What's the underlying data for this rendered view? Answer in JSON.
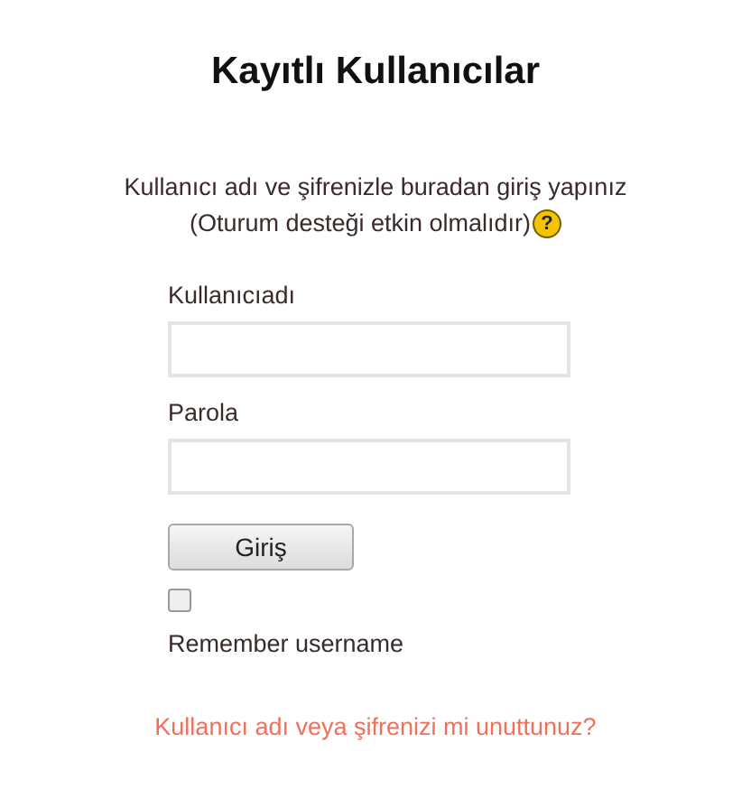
{
  "title": "Kayıtlı Kullanıcılar",
  "intro": [
    "Kullanıcı adı ve şifrenizle buradan giriş yapınız",
    "(Oturum desteği etkin olmalıdır)"
  ],
  "help_icon": "?",
  "fields": [
    {
      "label": "Kullanıcıadı"
    },
    {
      "label": "Parola"
    }
  ],
  "login_button": "Giriş",
  "remember": {
    "label": "Remember username",
    "checked": false
  },
  "forgot_link": "Kullanıcı adı veya şifrenizi mi unuttunuz?"
}
